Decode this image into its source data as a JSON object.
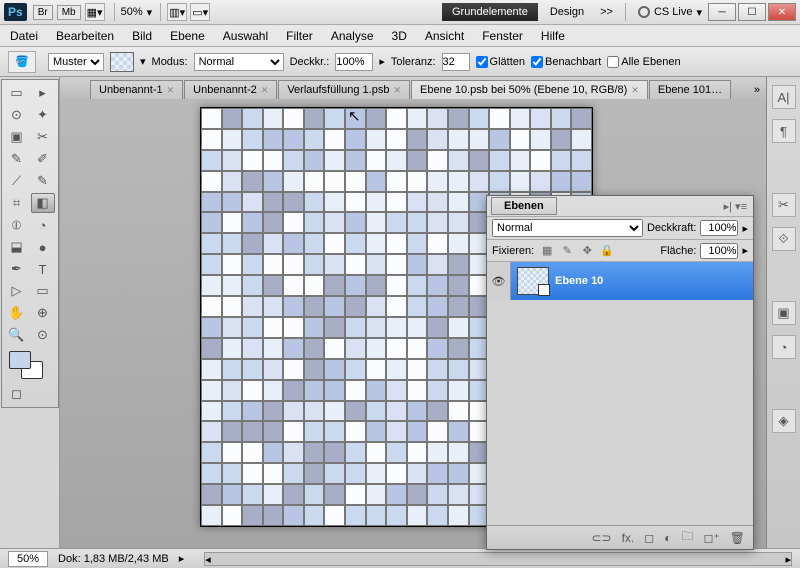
{
  "titlebar": {
    "ps": "Ps",
    "br": "Br",
    "mb": "Mb",
    "zoom": "50%",
    "workspace_active": "Grundelemente",
    "workspace_other": "Design",
    "chevrons": ">>",
    "cslive": "CS Live"
  },
  "menu": {
    "items": [
      "Datei",
      "Bearbeiten",
      "Bild",
      "Ebene",
      "Auswahl",
      "Filter",
      "Analyse",
      "3D",
      "Ansicht",
      "Fenster",
      "Hilfe"
    ]
  },
  "options": {
    "fill_label": "Muster",
    "mode_label": "Modus:",
    "mode_value": "Normal",
    "opacity_label": "Deckkr.:",
    "opacity_value": "100%",
    "tolerance_label": "Toleranz:",
    "tolerance_value": "32",
    "aa_label": "Glätten",
    "contig_label": "Benachbart",
    "all_label": "Alle Ebenen"
  },
  "tabs": [
    {
      "label": "Unbenannt-1",
      "active": false
    },
    {
      "label": "Unbenannt-2",
      "active": false
    },
    {
      "label": "Verlaufsfüllung 1.psb",
      "active": false
    },
    {
      "label": "Ebene 10.psb bei 50% (Ebene 10, RGB/8)",
      "active": true
    },
    {
      "label": "Ebene 101…",
      "active": false
    }
  ],
  "layers": {
    "title": "Ebenen",
    "blend": "Normal",
    "opacity_label": "Deckkraft:",
    "opacity_value": "100%",
    "lock_label": "Fixieren:",
    "fill_label": "Fläche:",
    "fill_value": "100%",
    "layer_name": "Ebene 10"
  },
  "status": {
    "zoom": "50%",
    "doc": "Dok: 1,83 MB/2,43 MB"
  },
  "tools": [
    "▭",
    "▸",
    "⊙",
    "✦",
    "▣",
    "✂",
    "✎",
    "✐",
    "⟋",
    "✎",
    "⌗",
    "◧",
    "⦶",
    "◔",
    "⬓",
    "●",
    "✒",
    "T",
    "▷",
    "▭",
    "✋",
    "⊕",
    "🔍",
    "⊙"
  ],
  "tile_colors": [
    "#cbd9ef",
    "#e9eff9",
    "#fbfcfd",
    "#a7aec6",
    "#d9e1f3",
    "#b8c6e3"
  ]
}
